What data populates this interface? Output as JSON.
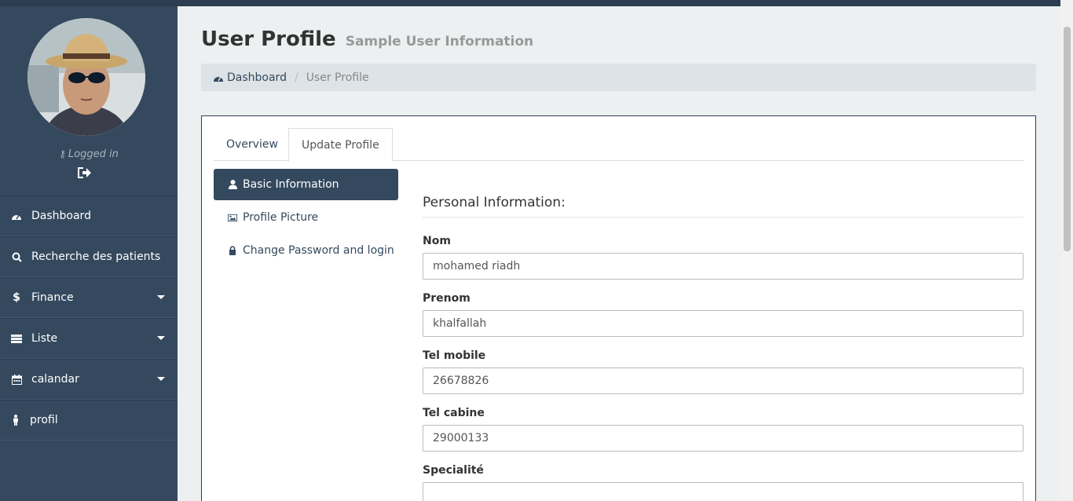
{
  "sidebar": {
    "status": "Logged in",
    "nav": [
      {
        "label": "Dashboard",
        "icon": "dashboard-icon"
      },
      {
        "label": "Recherche des patients",
        "icon": "search-icon"
      },
      {
        "label": "Finance",
        "icon": "dollar-icon"
      },
      {
        "label": "Liste",
        "icon": "list-icon"
      },
      {
        "label": "calandar",
        "icon": "calendar-icon"
      },
      {
        "label": "profil",
        "icon": "male-icon"
      }
    ]
  },
  "header": {
    "title": "User Profile",
    "subtitle": "Sample User Information"
  },
  "breadcrumb": {
    "home": "Dashboard",
    "current": "User Profile"
  },
  "tabs": [
    "Overview",
    "Update Profile"
  ],
  "pills": [
    "Basic Information",
    "Profile Picture",
    "Change Password and login"
  ],
  "form": {
    "heading": "Personal Information:",
    "fields": [
      {
        "label": "Nom",
        "value": "mohamed riadh"
      },
      {
        "label": "Prenom",
        "value": "khalfallah"
      },
      {
        "label": "Tel mobile",
        "value": "26678826"
      },
      {
        "label": "Tel cabine",
        "value": "29000133"
      },
      {
        "label": "Specialité",
        "value": ""
      }
    ]
  },
  "colors": {
    "sidebar": "#34495e",
    "topbar": "#2c3e50",
    "content_bg": "#ecf0f1"
  }
}
